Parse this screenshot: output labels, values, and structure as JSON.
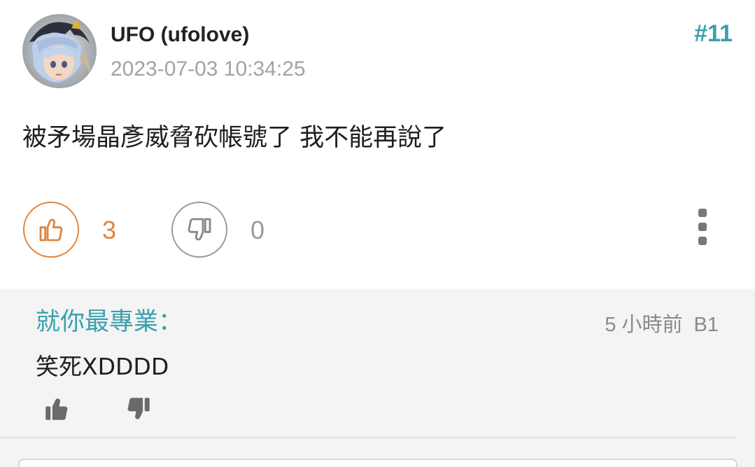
{
  "post": {
    "author": "UFO (ufolove)",
    "timestamp": "2023-07-03 10:34:25",
    "floor": "#11",
    "body": "被矛場晶彥威脅砍帳號了 我不能再說了",
    "likes": "3",
    "dislikes": "0"
  },
  "reply": {
    "name": "就你最專業：",
    "time_ago": "5 小時前",
    "floor": "B1",
    "text": "笑死XDDDD"
  },
  "icons": {
    "like": "thumbs-up-icon",
    "dislike": "thumbs-down-icon",
    "more": "more-vertical-icon"
  },
  "colors": {
    "accent_teal": "#3aa0ad",
    "like_orange": "#e1843a",
    "muted_gray": "#a3a3a3",
    "reply_background": "#f4f4f4"
  }
}
